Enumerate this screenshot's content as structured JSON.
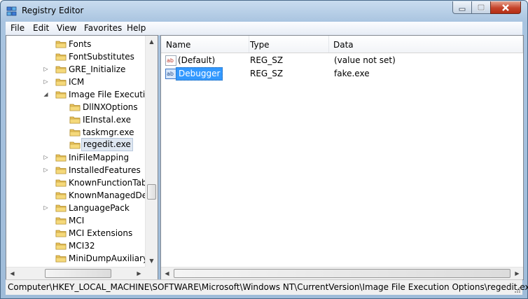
{
  "window": {
    "title": "Registry Editor",
    "icon": "registry-editor-icon"
  },
  "menu": [
    "File",
    "Edit",
    "View",
    "Favorites",
    "Help"
  ],
  "tree": {
    "items": [
      {
        "label": "Fonts",
        "level": 0,
        "expander": "none"
      },
      {
        "label": "FontSubstitutes",
        "level": 0,
        "expander": "none"
      },
      {
        "label": "GRE_Initialize",
        "level": 0,
        "expander": "collapsed"
      },
      {
        "label": "ICM",
        "level": 0,
        "expander": "collapsed"
      },
      {
        "label": "Image File Execution",
        "level": 0,
        "expander": "expanded"
      },
      {
        "label": "DllNXOptions",
        "level": 1,
        "expander": "none"
      },
      {
        "label": "IEInstal.exe",
        "level": 1,
        "expander": "none"
      },
      {
        "label": "taskmgr.exe",
        "level": 1,
        "expander": "none"
      },
      {
        "label": "regedit.exe",
        "level": 1,
        "expander": "none",
        "selected": true
      },
      {
        "label": "IniFileMapping",
        "level": 0,
        "expander": "collapsed"
      },
      {
        "label": "InstalledFeatures",
        "level": 0,
        "expander": "collapsed"
      },
      {
        "label": "KnownFunctionTable",
        "level": 0,
        "expander": "none"
      },
      {
        "label": "KnownManagedDeb",
        "level": 0,
        "expander": "none"
      },
      {
        "label": "LanguagePack",
        "level": 0,
        "expander": "collapsed"
      },
      {
        "label": "MCI",
        "level": 0,
        "expander": "none"
      },
      {
        "label": "MCI Extensions",
        "level": 0,
        "expander": "none"
      },
      {
        "label": "MCI32",
        "level": 0,
        "expander": "none"
      },
      {
        "label": "MiniDumpAuxiliaryD",
        "level": 0,
        "expander": "none"
      }
    ]
  },
  "list": {
    "columns": [
      "Name",
      "Type",
      "Data"
    ],
    "rows": [
      {
        "name": "(Default)",
        "type": "REG_SZ",
        "data": "(value not set)",
        "selected": false
      },
      {
        "name": "Debugger",
        "type": "REG_SZ",
        "data": "fake.exe",
        "selected": true
      }
    ]
  },
  "status": {
    "path": "Computer\\HKEY_LOCAL_MACHINE\\SOFTWARE\\Microsoft\\Windows NT\\CurrentVersion\\Image File Execution Options\\regedit.exe"
  },
  "colors": {
    "selection": "#3399ff",
    "folder": "#e8c25a"
  }
}
